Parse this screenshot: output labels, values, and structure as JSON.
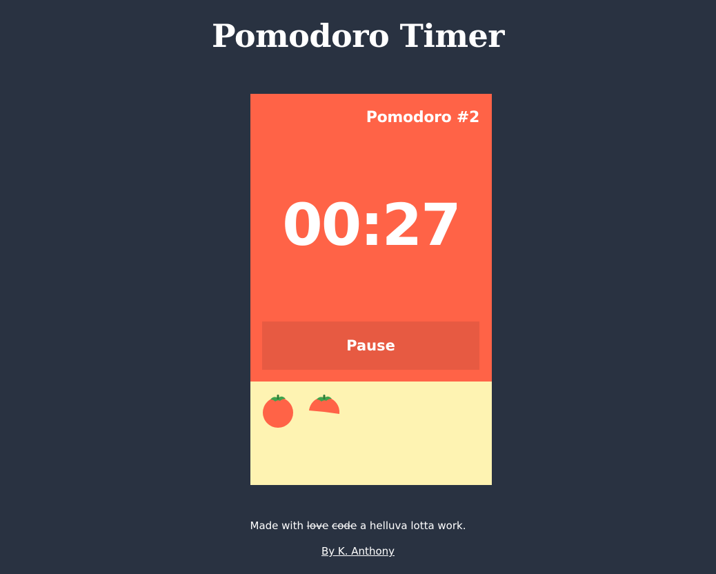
{
  "page": {
    "title": "Pomodoro Timer"
  },
  "timer": {
    "session_label": "Pomodoro #2",
    "time": "00:27",
    "pause_label": "Pause"
  },
  "tomatoes": {
    "completed": 1,
    "in_progress_fraction": 0.5,
    "icons": [
      "tomato-icon",
      "partial-tomato-icon"
    ]
  },
  "footer": {
    "made_with": "Made with",
    "love": "love",
    "code": "code",
    "rest": "a helluva lotta work.",
    "author": "By K. Anthony"
  },
  "colors": {
    "background": "#293241",
    "timer_panel": "#ff6347",
    "pause_button": "#e75a42",
    "tomato_panel": "#fef3b2",
    "tomato": "#ff6347",
    "stem": "#3fa34d"
  }
}
